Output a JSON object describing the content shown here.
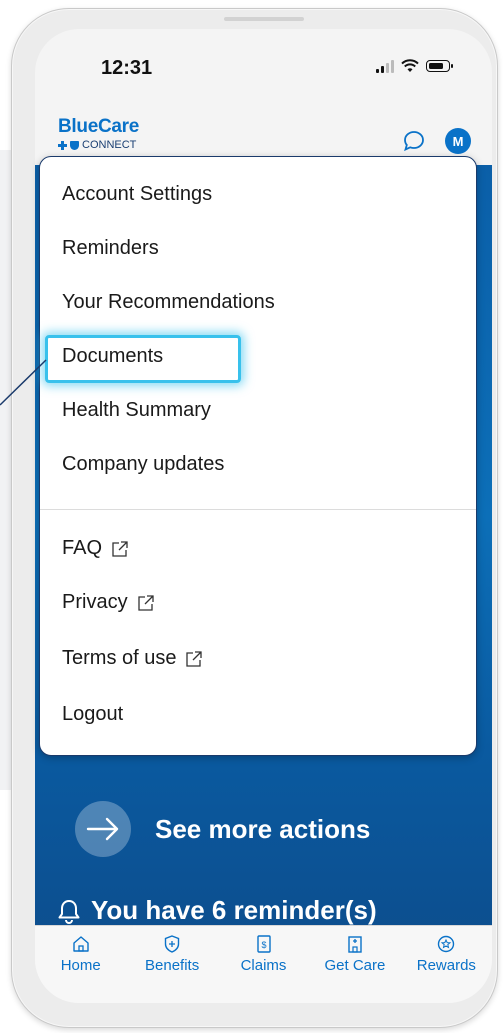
{
  "status": {
    "time": "12:31"
  },
  "header": {
    "logo_title": "BlueCare",
    "logo_sub": "CONNECT",
    "avatar_initial": "M"
  },
  "menu": {
    "primary_items": [
      {
        "label": "Account Settings"
      },
      {
        "label": "Reminders"
      },
      {
        "label": "Your Recommendations"
      },
      {
        "label": "Documents",
        "highlighted": true
      },
      {
        "label": "Health Summary"
      },
      {
        "label": "Company updates"
      }
    ],
    "secondary_items": [
      {
        "label": "FAQ",
        "external": true
      },
      {
        "label": "Privacy",
        "external": true
      },
      {
        "label": "Terms of use",
        "external": true
      },
      {
        "label": "Logout",
        "external": false
      }
    ]
  },
  "content": {
    "actions_label": "See more actions",
    "reminder_text": "You have 6 reminder(s)"
  },
  "nav": {
    "items": [
      {
        "label": "Home",
        "icon": "home-icon"
      },
      {
        "label": "Benefits",
        "icon": "shield-plus-icon"
      },
      {
        "label": "Claims",
        "icon": "dollar-document-icon"
      },
      {
        "label": "Get Care",
        "icon": "hospital-icon"
      },
      {
        "label": "Rewards",
        "icon": "star-badge-icon"
      }
    ]
  },
  "colors": {
    "brand": "#0a72c8",
    "highlight": "#38c1ec",
    "menu_border": "#1a3a6b"
  }
}
